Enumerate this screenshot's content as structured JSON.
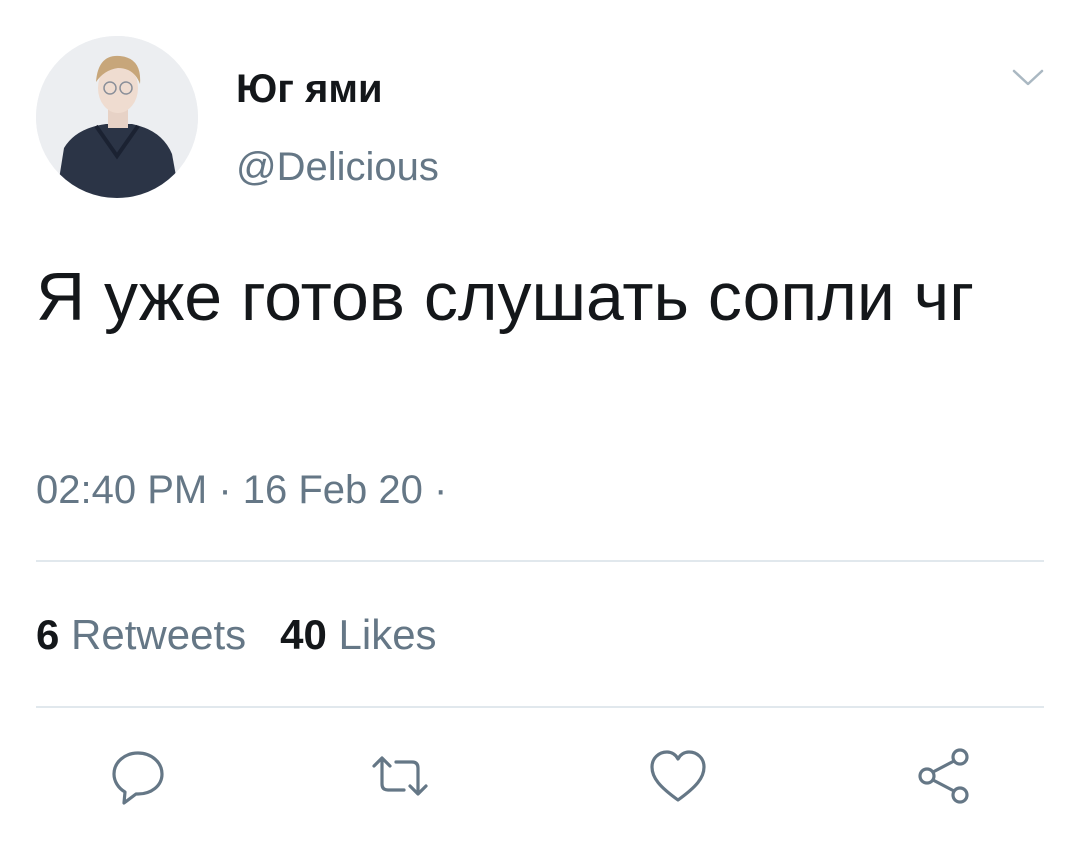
{
  "tweet": {
    "display_name": "Юг ями",
    "handle": "@Delicious",
    "text": "Я уже готов слушать сопли чг",
    "timestamp": "02:40 PM · 16 Feb 20 ·"
  },
  "stats": {
    "retweets_count": "6",
    "retweets_label": "Retweets",
    "likes_count": "40",
    "likes_label": "Likes"
  },
  "icons": {
    "menu": "chevron-down-icon",
    "reply": "reply-icon",
    "retweet": "retweet-icon",
    "like": "heart-icon",
    "share": "share-icon"
  },
  "colors": {
    "primary_text": "#14171a",
    "secondary_text": "#657786",
    "divider": "#e1e8ed"
  }
}
